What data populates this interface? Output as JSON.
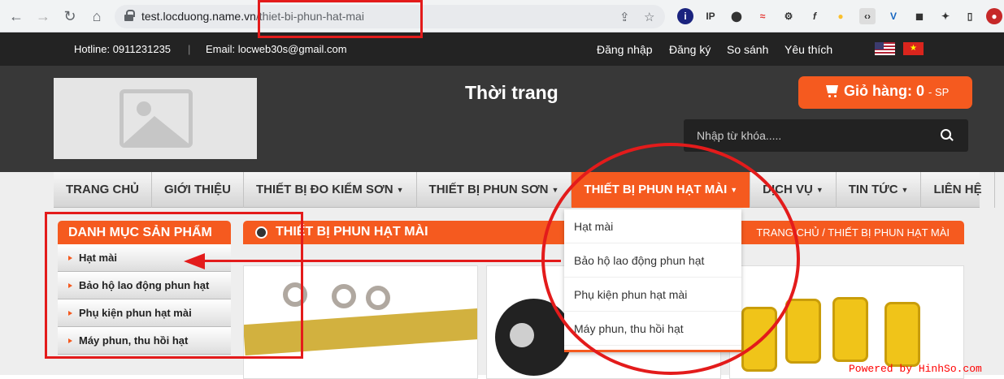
{
  "browser": {
    "url_domain": "test.locduong.name.vn",
    "url_path": "/thiet-bi-phun-hat-mai"
  },
  "topbar": {
    "hotline": "Hotline: 0911231235",
    "email": "Email: locweb30s@gmail.com",
    "links": [
      "Đăng nhập",
      "Đăng ký",
      "So sánh",
      "Yêu thích"
    ]
  },
  "header": {
    "site_title": "Thời trang",
    "cart_label": "Giỏ hàng:",
    "cart_count": "0",
    "cart_unit": "- SP",
    "search_placeholder": "Nhập từ khóa....."
  },
  "nav": {
    "items": [
      {
        "label": "TRANG CHỦ",
        "caret": false
      },
      {
        "label": "GIỚI THIỆU",
        "caret": false
      },
      {
        "label": "THIẾT BỊ ĐO KIỂM SƠN",
        "caret": true
      },
      {
        "label": "THIẾT BỊ PHUN SƠN",
        "caret": true
      },
      {
        "label": "THIẾT BỊ PHUN HẠT MÀI",
        "caret": true,
        "active": true
      },
      {
        "label": "DỊCH VỤ",
        "caret": true
      },
      {
        "label": "TIN TỨC",
        "caret": true
      },
      {
        "label": "LIÊN HỆ",
        "caret": false
      }
    ],
    "dropdown": [
      "Hạt mài",
      "Bảo hộ lao động phun hạt",
      "Phụ kiện phun hạt mài",
      "Máy phun, thu hồi hạt"
    ]
  },
  "sidebar": {
    "title": "DANH MỤC SẢN PHẨM",
    "items": [
      "Hạt mài",
      "Bảo hộ lao động phun hạt",
      "Phụ kiện phun hạt mài",
      "Máy phun, thu hồi hạt"
    ]
  },
  "main": {
    "title": "THIẾT BỊ PHUN HẠT MÀI",
    "breadcrumb": "TRANG CHỦ / THIẾT BỊ PHUN HẠT MÀI"
  },
  "watermark": "Powered by HinhSo.com",
  "colors": {
    "accent": "#f55a1f",
    "annotation": "#e31b1b",
    "dark": "#383838"
  }
}
